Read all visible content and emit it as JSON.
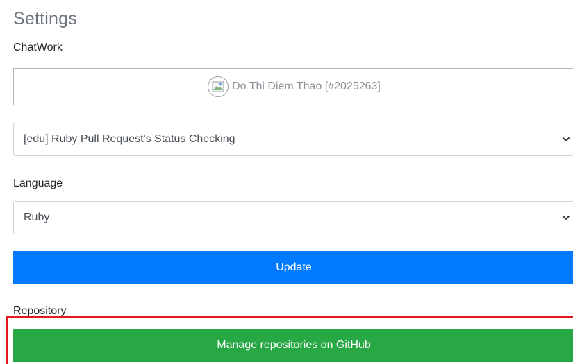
{
  "page": {
    "title": "Settings"
  },
  "chatwork": {
    "label": "ChatWork",
    "account_name": "Do Thi Diem Thao [#2025263]",
    "avatar_icon": "broken-image-icon",
    "room_selected": "[edu] Ruby Pull Request's Status Checking"
  },
  "language": {
    "label": "Language",
    "selected": "Ruby"
  },
  "actions": {
    "update_label": "Update"
  },
  "repository": {
    "label": "Repository",
    "manage_label": "Manage repositories on GitHub"
  },
  "colors": {
    "primary": "#007bff",
    "success": "#28a745",
    "highlight": "#e0181f"
  }
}
